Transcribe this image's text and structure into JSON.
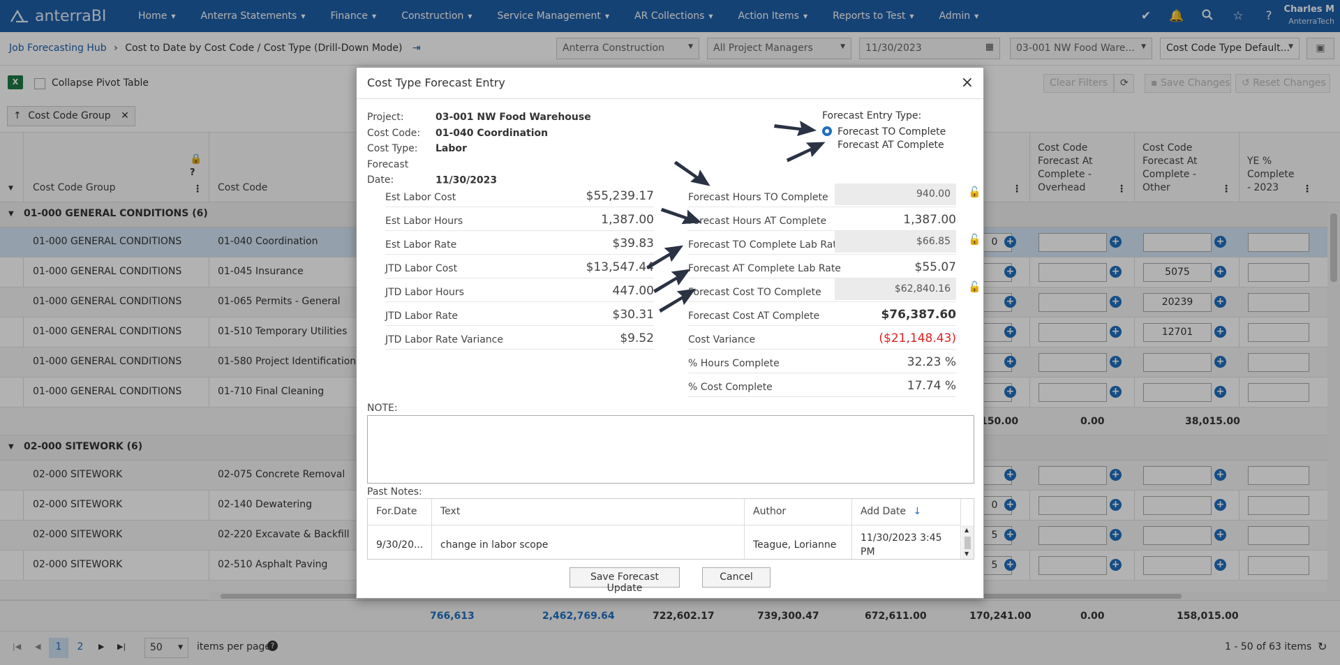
{
  "brand": "anterraBI",
  "nav": [
    "Home",
    "Anterra Statements",
    "Finance",
    "Construction",
    "Service Management",
    "AR Collections",
    "Action Items",
    "Reports to Test",
    "Admin"
  ],
  "user": {
    "name": "Charles M",
    "company": "AnterraTech"
  },
  "breadcrumb": {
    "root": "Job Forecasting Hub",
    "current": "Cost to Date by Cost Code / Cost Type  (Drill-Down Mode)"
  },
  "filters": {
    "company": "Anterra Construction",
    "managers": "All Project Managers",
    "date": "11/30/2023",
    "project": "03-001 NW Food Ware...",
    "layout": "Cost Code Type Default..."
  },
  "toolbar": {
    "collapse_label": "Collapse Pivot Table",
    "clear_filters": "Clear Filters",
    "save_changes": "Save Changes",
    "reset_changes": "Reset Changes"
  },
  "chip": {
    "label": "Cost Code Group"
  },
  "grid": {
    "headers": {
      "cost_code_group": "Cost Code Group",
      "cost_code": "Cost Code",
      "overhead": [
        "Cost Code",
        "Forecast At",
        "Complete -",
        "Overhead"
      ],
      "other": [
        "Cost Code",
        "Forecast At",
        "Complete -",
        "Other"
      ],
      "ye": [
        "YE %",
        "Complete",
        "- 2023"
      ]
    },
    "group1": {
      "label": "01-000 GENERAL CONDITIONS (6)"
    },
    "group1_rows": [
      {
        "group": "01-000 GENERAL CONDITIONS",
        "code": "01-040 Coordination",
        "peek": "0",
        "other": ""
      },
      {
        "group": "01-000 GENERAL CONDITIONS",
        "code": "01-045 Insurance",
        "peek": "",
        "other": "5075"
      },
      {
        "group": "01-000 GENERAL CONDITIONS",
        "code": "01-065 Permits - General",
        "peek": "",
        "other": "20239"
      },
      {
        "group": "01-000 GENERAL CONDITIONS",
        "code": "01-510 Temporary Utilities",
        "peek": "",
        "other": "12701"
      },
      {
        "group": "01-000 GENERAL CONDITIONS",
        "code": "01-580 Project Identification",
        "peek": "",
        "other": ""
      },
      {
        "group": "01-000 GENERAL CONDITIONS",
        "code": "01-710 Final Cleaning",
        "peek": "",
        "other": ""
      }
    ],
    "group1_subtotals": {
      "peek": "2,150.00",
      "overhead": "0.00",
      "other": "38,015.00"
    },
    "group2": {
      "label": "02-000 SITEWORK (6)"
    },
    "group2_rows": [
      {
        "group": "02-000 SITEWORK",
        "code": "02-075 Concrete Removal",
        "peek": ""
      },
      {
        "group": "02-000 SITEWORK",
        "code": "02-140 Dewatering",
        "peek": "0"
      },
      {
        "group": "02-000 SITEWORK",
        "code": "02-220 Excavate & Backfill",
        "peek": "5"
      },
      {
        "group": "02-000 SITEWORK",
        "code": "02-510 Asphalt Paving",
        "peek": "5"
      }
    ],
    "footer_totals": [
      "766,613",
      "2,462,769.64",
      "722,602.17",
      "739,300.47",
      "672,611.00",
      "170,241.00",
      "0.00",
      "158,015.00"
    ]
  },
  "pager": {
    "page1": "1",
    "page2": "2",
    "page_size": "50",
    "per_page_label": "items per page",
    "summary": "1 - 50 of 63 items"
  },
  "modal": {
    "title": "Cost Type Forecast Entry",
    "info": [
      {
        "label": "Project:",
        "value": "03-001 NW Food Warehouse"
      },
      {
        "label": "Cost Code:",
        "value": "01-040 Coordination"
      },
      {
        "label": "Cost Type:",
        "value": "Labor"
      },
      {
        "label": "Forecast Date:",
        "value": "11/30/2023"
      }
    ],
    "entry_type": {
      "label": "Forecast Entry Type:",
      "option_to": "Forecast TO Complete",
      "option_at": "Forecast AT Complete",
      "selected": "Forecast TO Complete"
    },
    "left": [
      {
        "label": "Est Labor Cost",
        "value": "$55,239.17"
      },
      {
        "label": "Est Labor Hours",
        "value": "1,387.00"
      },
      {
        "label": "Est Labor Rate",
        "value": "$39.83"
      },
      {
        "label": "JTD Labor Cost",
        "value": "$13,547.44"
      },
      {
        "label": "JTD Labor Hours",
        "value": "447.00"
      },
      {
        "label": "JTD Labor Rate",
        "value": "$30.31"
      },
      {
        "label": "JTD Labor Rate Variance",
        "value": "$9.52"
      }
    ],
    "right": [
      {
        "label": "Forecast Hours TO Complete",
        "value": "940.00"
      },
      {
        "label": "Forecast Hours AT Complete",
        "value": "1,387.00"
      },
      {
        "label": "Forecast TO Complete Lab Rate",
        "value": "$66.85"
      },
      {
        "label": "Forecast AT Complete Lab Rate",
        "value": "$55.07"
      },
      {
        "label": "Forecast Cost TO Complete",
        "value": "$62,840.16"
      },
      {
        "label": "Forecast Cost AT Complete",
        "value": "$76,387.60"
      },
      {
        "label": "Cost Variance",
        "value": "($21,148.43)"
      },
      {
        "label": "% Hours Complete",
        "value": "32.23 %"
      },
      {
        "label": "% Cost Complete",
        "value": "17.74 %"
      }
    ],
    "note_label": "NOTE:",
    "past_notes_label": "Past Notes:",
    "past_notes_headers": [
      "For.Date",
      "Text",
      "Author",
      "Add Date"
    ],
    "past_notes_rows": [
      {
        "date": "9/30/20...",
        "text": "change in labor scope",
        "author": "Teague, Lorianne",
        "added": "11/30/2023 3:45 PM"
      }
    ],
    "save_label": "Save Forecast Update",
    "cancel_label": "Cancel"
  },
  "colors": {
    "nav_bg": "#1f5fa8",
    "accent": "#1f6fc0",
    "negative": "#e02020",
    "arrow": "#2a3244"
  }
}
